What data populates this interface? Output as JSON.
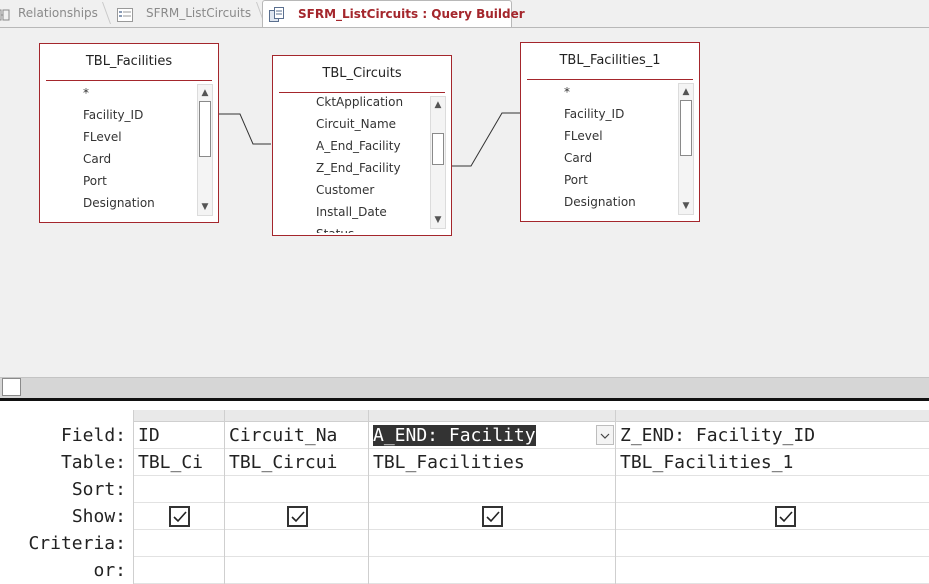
{
  "tabs": [
    {
      "label": "Relationships",
      "icon": "relationships-icon",
      "active": false
    },
    {
      "label": "SFRM_ListCircuits",
      "icon": "form-icon",
      "active": false
    },
    {
      "label": "SFRM_ListCircuits : Query Builder",
      "icon": "query-icon",
      "active": true
    }
  ],
  "tables": [
    {
      "title": "TBL_Facilities",
      "fields": [
        "*",
        "Facility_ID",
        "FLevel",
        "Card",
        "Port",
        "Designation"
      ]
    },
    {
      "title": "TBL_Circuits",
      "fields": [
        "CktApplication",
        "Circuit_Name",
        "A_End_Facility",
        "Z_End_Facility",
        "Customer",
        "Install_Date",
        "Status"
      ]
    },
    {
      "title": "TBL_Facilities_1",
      "fields": [
        "*",
        "Facility_ID",
        "FLevel",
        "Card",
        "Port",
        "Designation"
      ]
    }
  ],
  "grid": {
    "row_labels": {
      "field": "Field:",
      "table": "Table:",
      "sort": "Sort:",
      "show": "Show:",
      "criteria": "Criteria:",
      "or": "or:"
    },
    "columns": [
      {
        "field": "ID",
        "table": "TBL_Ci",
        "show": true
      },
      {
        "field": "Circuit_Na",
        "table": "TBL_Circui",
        "show": true
      },
      {
        "field": "A_END: Facility",
        "table": "TBL_Facilities",
        "show": true,
        "selected": true
      },
      {
        "field": "Z_END: Facility_ID",
        "table": "TBL_Facilities_1",
        "show": true
      }
    ]
  },
  "colors": {
    "accent": "#a4262c",
    "design_bg": "#f0f0f0",
    "selection": "#333333"
  }
}
